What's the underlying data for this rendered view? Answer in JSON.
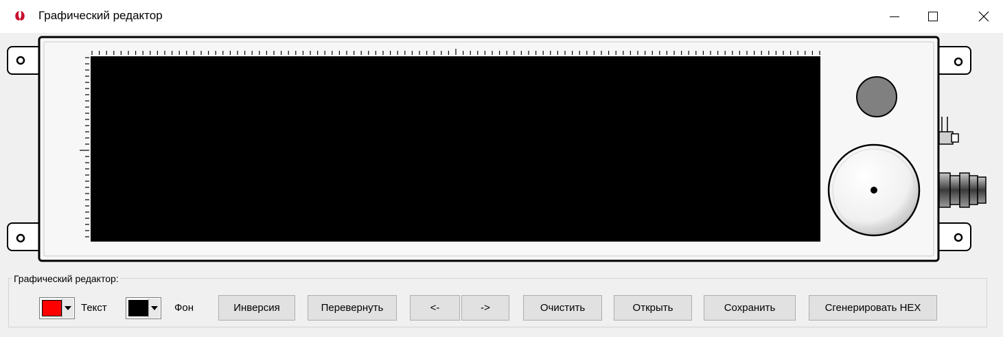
{
  "window": {
    "title": "Графический редактор",
    "app_icon": "app-logo-icon",
    "controls": [
      "minimize-icon",
      "maximize-icon",
      "close-icon"
    ]
  },
  "device": {
    "screen_color": "#000000",
    "indicator_color": "#808080"
  },
  "editor_group": {
    "legend": "Графический редактор:",
    "text_color": {
      "label": "Текст",
      "value": "#ff0000"
    },
    "bg_color": {
      "label": "Фон",
      "value": "#000000"
    },
    "buttons": {
      "invert": "Инверсия",
      "flip": "Перевернуть",
      "left": "<-",
      "right": "->",
      "clear": "Очистить",
      "open": "Открыть",
      "save": "Сохранить",
      "generate_hex": "Сгенерировать HEX"
    }
  }
}
